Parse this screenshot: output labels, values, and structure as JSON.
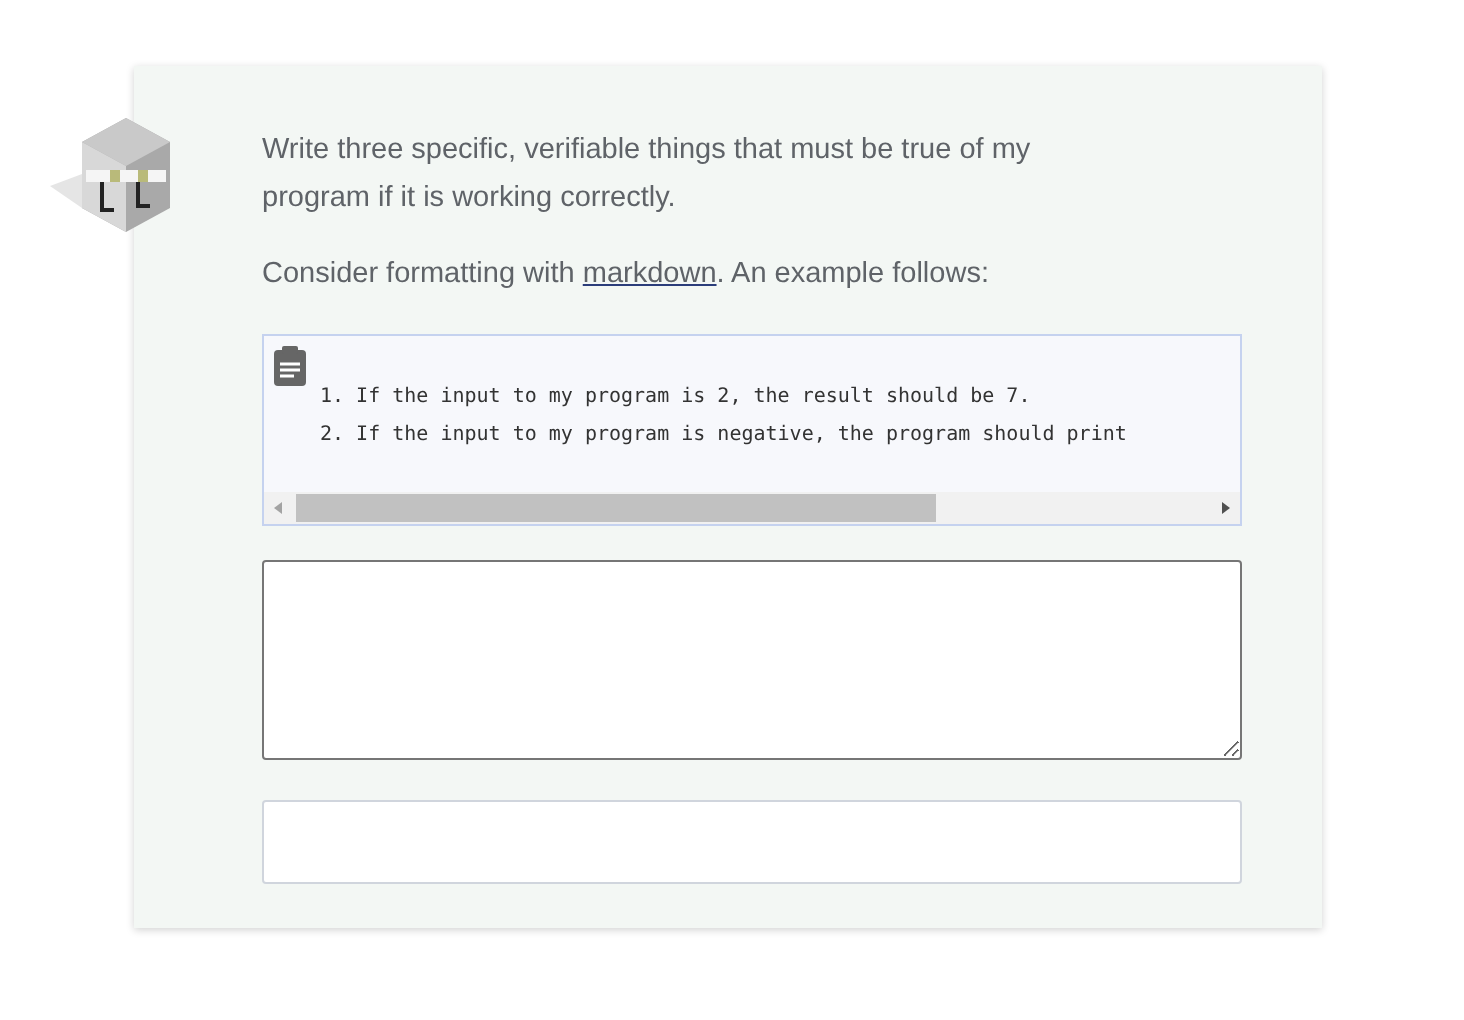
{
  "prompt": "Write three specific, verifiable things that must be true of my program if it is working correctly.",
  "hint": {
    "before": "Consider formatting with ",
    "link": "markdown",
    "after": ". An example follows:"
  },
  "example": {
    "lines": [
      "1. If the input to my program is 2, the result should be 7.",
      "2. If the input to my program is negative, the program should print"
    ]
  }
}
